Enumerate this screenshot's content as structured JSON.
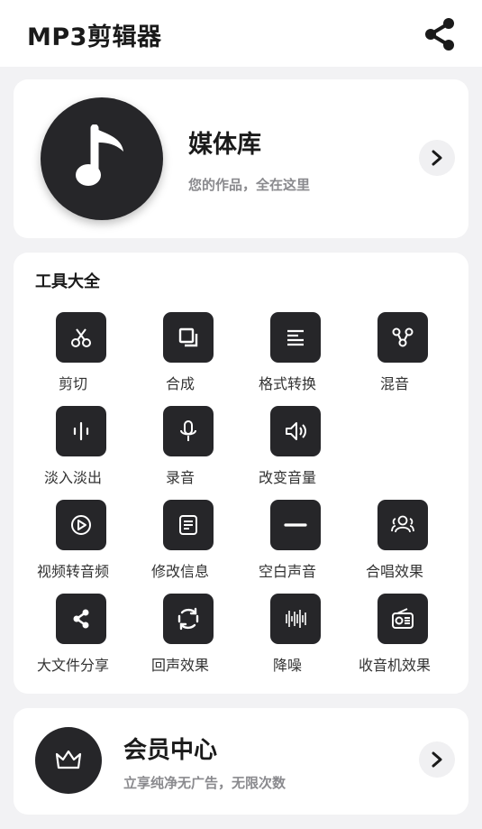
{
  "header": {
    "title": "MP3剪辑器",
    "share_icon": "share-icon"
  },
  "media": {
    "title": "媒体库",
    "subtitle": "您的作品，全在这里",
    "icon": "music-note-icon"
  },
  "tools": {
    "title": "工具大全",
    "items": [
      {
        "label": "剪切",
        "icon": "scissors-icon"
      },
      {
        "label": "合成",
        "icon": "merge-icon"
      },
      {
        "label": "格式转换",
        "icon": "format-lines-icon"
      },
      {
        "label": "混音",
        "icon": "mix-nodes-icon"
      },
      {
        "label": "淡入淡出",
        "icon": "waveform-icon"
      },
      {
        "label": "录音",
        "icon": "microphone-icon"
      },
      {
        "label": "改变音量",
        "icon": "speaker-icon"
      },
      {
        "label": "视频转音频",
        "icon": "play-circle-icon"
      },
      {
        "label": "修改信息",
        "icon": "document-icon"
      },
      {
        "label": "空白声音",
        "icon": "minus-icon"
      },
      {
        "label": "合唱效果",
        "icon": "group-icon"
      },
      {
        "label": "大文件分享",
        "icon": "share-icon"
      },
      {
        "label": "回声效果",
        "icon": "refresh-icon"
      },
      {
        "label": "降噪",
        "icon": "bars-icon"
      },
      {
        "label": "收音机效果",
        "icon": "radio-icon"
      }
    ]
  },
  "vip": {
    "title": "会员中心",
    "subtitle": "立享纯净无广告，无限次数",
    "icon": "crown-icon"
  },
  "colors": {
    "accent": "#262629",
    "background": "#f2f2f4",
    "card": "#ffffff"
  }
}
